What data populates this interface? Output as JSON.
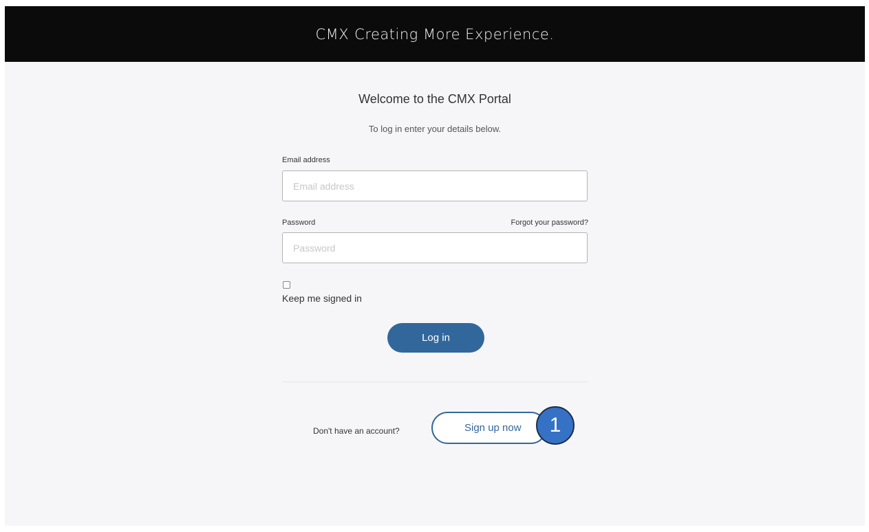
{
  "header": {
    "brand_short": "CMX",
    "brand_tagline": "Creating More Experience."
  },
  "login": {
    "title": "Welcome to the CMX Portal",
    "subtitle": "To log in enter your details below.",
    "email_label": "Email address",
    "email_placeholder": "Email address",
    "email_value": "",
    "password_label": "Password",
    "password_placeholder": "Password",
    "password_value": "",
    "forgot_link": "Forgot your password?",
    "keep_signed_in_label": "Keep me signed in",
    "keep_signed_in_checked": false,
    "login_button": "Log in"
  },
  "signup": {
    "prompt": "Don't have an account?",
    "button": "Sign up now"
  },
  "annotation": {
    "badge_number": "1"
  },
  "colors": {
    "header_bg": "#0b0b0b",
    "page_bg": "#f6f6f8",
    "primary": "#32679c",
    "badge": "#3572c6"
  }
}
